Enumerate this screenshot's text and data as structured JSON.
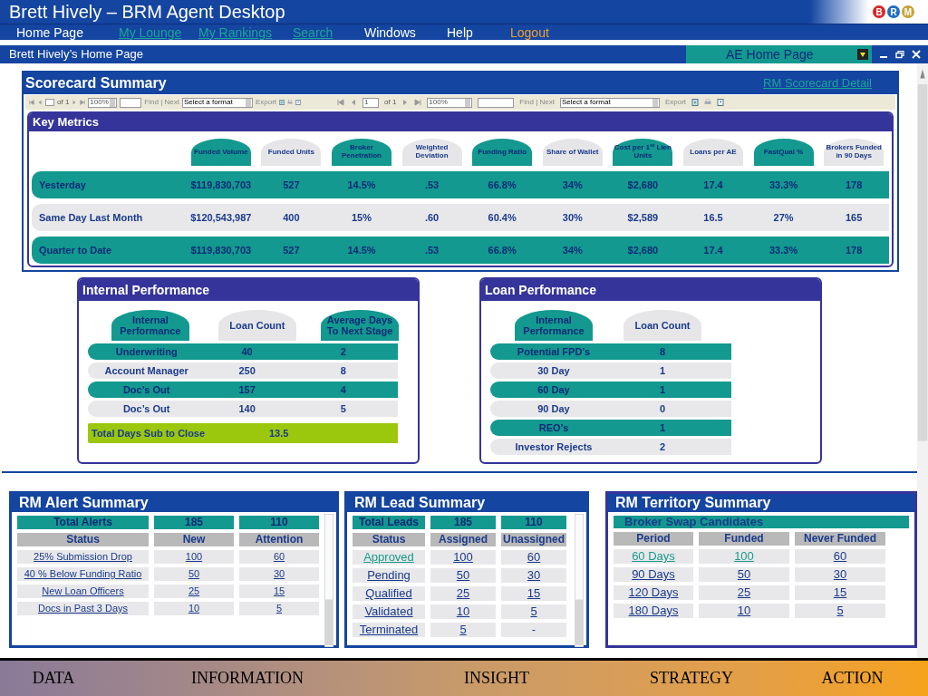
{
  "window": {
    "title": "Brett Hively – BRM Agent Desktop",
    "logo_letters": [
      {
        "text": "B",
        "color": "#d42a2a"
      },
      {
        "text": "R",
        "color": "#1f6fc4"
      },
      {
        "text": "M",
        "color": "#c9a23a"
      }
    ]
  },
  "menu": [
    {
      "label": "Home Page",
      "kind": "plain"
    },
    {
      "label": "My Lounge",
      "kind": "link"
    },
    {
      "label": "My Rankings",
      "kind": "link"
    },
    {
      "label": "Search",
      "kind": "link"
    },
    {
      "label": "Windows",
      "kind": "plain"
    },
    {
      "label": "Help",
      "kind": "plain"
    },
    {
      "label": "Logout",
      "kind": "logout"
    }
  ],
  "page_bar": {
    "title": "Brett Hively’s Home Page",
    "view_select": "AE Home Page"
  },
  "scorecard": {
    "title": "Scorecard Summary",
    "link": "RM Scorecard Detail",
    "toolbars": [
      {
        "kind": "small",
        "of": "of 1",
        "zoom": "100%",
        "find_next": "Find | Next",
        "format": "Select a format",
        "export": "Export"
      },
      {
        "kind": "large",
        "page": "1",
        "of": "of 1",
        "zoom": "100%",
        "find_next": "Find | Next",
        "format": "Select a format",
        "export": "Export"
      }
    ],
    "key_metrics": {
      "title": "Key Metrics",
      "columns": [
        {
          "label": "Funded Volume",
          "highlighted": true
        },
        {
          "label": "Funded Units",
          "highlighted": false
        },
        {
          "label": "Broker Penetration",
          "highlighted": true
        },
        {
          "label": "Weighted Deviation",
          "highlighted": false
        },
        {
          "label": "Funding Ratio",
          "highlighted": true
        },
        {
          "label": "Share of Wallet",
          "highlighted": false
        },
        {
          "label": "Cost per 1$^{st}$ Lien Units",
          "highlighted": true
        },
        {
          "label": "Loans per AE",
          "highlighted": false
        },
        {
          "label": "FastQual %",
          "highlighted": true
        },
        {
          "label": "Brokers Funded in 90 Days",
          "highlighted": false
        }
      ],
      "rows": [
        {
          "label": "Yesterday",
          "highlighted": true,
          "cells": [
            "$119,830,703",
            "527",
            "14.5%",
            ".53",
            "66.8%",
            "34%",
            "$2,680",
            "17.4",
            "33.3%",
            "178"
          ]
        },
        {
          "label": "Same Day Last Month",
          "highlighted": false,
          "cells": [
            "$120,543,987",
            "400",
            "15%",
            ".60",
            "60.4%",
            "30%",
            "$2,589",
            "16.5",
            "27%",
            "165"
          ]
        },
        {
          "label": "Quarter to Date",
          "highlighted": true,
          "cells": [
            "$119,830,703",
            "527",
            "14.5%",
            ".53",
            "66.8%",
            "34%",
            "$2,680",
            "17.4",
            "33.3%",
            "178"
          ]
        }
      ]
    }
  },
  "internal_performance": {
    "title": "Internal Performance",
    "columns": [
      {
        "label": "Internal Performance",
        "highlighted": true
      },
      {
        "label": "Loan Count",
        "highlighted": false
      },
      {
        "label": "Average Days To Next Stage",
        "highlighted": true
      }
    ],
    "rows": [
      {
        "kind": "highlight",
        "cells": [
          "Underwriting",
          "40",
          "2"
        ]
      },
      {
        "kind": "plain",
        "cells": [
          "Account Manager",
          "250",
          "8"
        ]
      },
      {
        "kind": "highlight",
        "cells": [
          "Doc’s Out",
          "157",
          "4"
        ]
      },
      {
        "kind": "plain",
        "cells": [
          "Doc’s Out",
          "140",
          "5"
        ]
      },
      {
        "kind": "total",
        "cells": [
          "Total Days Sub to Close",
          "13.5"
        ]
      }
    ]
  },
  "loan_performance": {
    "title": "Loan Performance",
    "columns": [
      {
        "label": "Internal Performance",
        "highlighted": true
      },
      {
        "label": "Loan Count",
        "highlighted": false
      }
    ],
    "rows": [
      {
        "kind": "highlight",
        "cells": [
          "Potential FPD’s",
          "8"
        ]
      },
      {
        "kind": "plain",
        "cells": [
          "30 Day",
          "1"
        ]
      },
      {
        "kind": "highlight",
        "cells": [
          "60 Day",
          "1"
        ]
      },
      {
        "kind": "plain",
        "cells": [
          "90 Day",
          "0"
        ]
      },
      {
        "kind": "highlight",
        "cells": [
          "REO’s",
          "1"
        ]
      },
      {
        "kind": "plain",
        "cells": [
          "Investor Rejects",
          "2"
        ]
      }
    ]
  },
  "summaries": [
    {
      "title": "RM Alert Summary",
      "scrollable": true,
      "total": [
        "Total Alerts",
        "185",
        "110"
      ],
      "header": [
        "Status",
        "New",
        "Attention"
      ],
      "rows": [
        [
          {
            "text": "25% Submission Drop",
            "kind": "link"
          },
          {
            "text": "100",
            "kind": "link"
          },
          {
            "text": "60",
            "kind": "link"
          }
        ],
        [
          {
            "text": "40 % Below Funding Ratio",
            "kind": "link"
          },
          {
            "text": "50",
            "kind": "link"
          },
          {
            "text": "30",
            "kind": "link"
          }
        ],
        [
          {
            "text": "New Loan Officers",
            "kind": "link"
          },
          {
            "text": "25",
            "kind": "link"
          },
          {
            "text": "15",
            "kind": "link"
          }
        ],
        [
          {
            "text": "Docs in Past 3 Days",
            "kind": "link"
          },
          {
            "text": "10",
            "kind": "link"
          },
          {
            "text": "5",
            "kind": "link"
          }
        ]
      ]
    },
    {
      "title": "RM Lead Summary",
      "scrollable": true,
      "total": [
        "Total Leads",
        "185",
        "110"
      ],
      "header": [
        "Status",
        "Assigned",
        "Unassigned"
      ],
      "rows": [
        [
          {
            "text": "Approved",
            "kind": "visited"
          },
          {
            "text": "100",
            "kind": "link"
          },
          {
            "text": "60",
            "kind": "link"
          }
        ],
        [
          {
            "text": "Pending",
            "kind": "link"
          },
          {
            "text": "50",
            "kind": "link"
          },
          {
            "text": "30",
            "kind": "link"
          }
        ],
        [
          {
            "text": "Qualified",
            "kind": "link"
          },
          {
            "text": "25",
            "kind": "link"
          },
          {
            "text": "15",
            "kind": "link"
          }
        ],
        [
          {
            "text": "Validated",
            "kind": "link"
          },
          {
            "text": "10",
            "kind": "link"
          },
          {
            "text": "5",
            "kind": "link"
          }
        ],
        [
          {
            "text": "Terminated",
            "kind": "link"
          },
          {
            "text": "5",
            "kind": "link"
          },
          {
            "text": "-",
            "kind": "plain"
          }
        ]
      ]
    },
    {
      "title": "RM Territory Summary",
      "scrollable": false,
      "total": [
        "Broker Swap Candidates"
      ],
      "header": [
        "Period",
        "Funded",
        "Never Funded"
      ],
      "rows": [
        [
          {
            "text": "60 Days",
            "kind": "visited"
          },
          {
            "text": "100",
            "kind": "visited"
          },
          {
            "text": "60",
            "kind": "link"
          }
        ],
        [
          {
            "text": "90 Days",
            "kind": "link"
          },
          {
            "text": "50",
            "kind": "link"
          },
          {
            "text": "30",
            "kind": "link"
          }
        ],
        [
          {
            "text": "120 Days",
            "kind": "link"
          },
          {
            "text": "25",
            "kind": "link"
          },
          {
            "text": "15",
            "kind": "link"
          }
        ],
        [
          {
            "text": "180 Days",
            "kind": "link"
          },
          {
            "text": "10",
            "kind": "link"
          },
          {
            "text": "5",
            "kind": "link"
          }
        ]
      ]
    }
  ],
  "footer": [
    "DATA",
    "INFORMATION",
    "INSIGHT",
    "STRATEGY",
    "ACTION"
  ]
}
